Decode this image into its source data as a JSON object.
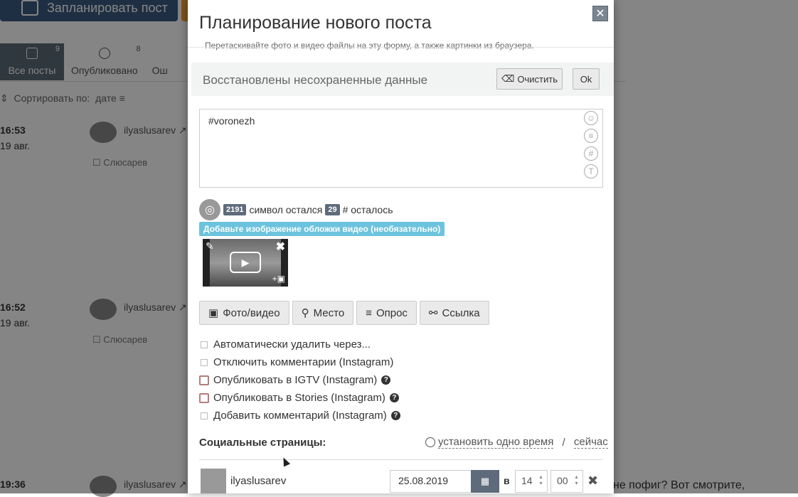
{
  "background": {
    "plan_button": "Запланировать пост",
    "tabs": [
      {
        "label": "Все посты",
        "count": "9"
      },
      {
        "label": "Опубликовано",
        "count": "8"
      },
      {
        "label": "Ош",
        "count": ""
      }
    ],
    "sort_label": "Сортировать по:",
    "sort_value": "дате",
    "posts": [
      {
        "time": "16:53",
        "date": "19 авг.",
        "user": "ilyaslusarev",
        "page": "Слюсарев"
      },
      {
        "time": "16:52",
        "date": "19 авг.",
        "user": "ilyaslusarev",
        "page": "Слюсарев"
      },
      {
        "time": "19:36",
        "date": "",
        "user": "ilyaslusarev",
        "page": ""
      }
    ],
    "right_text": "не пофиг? Вот смотрите,"
  },
  "modal": {
    "title": "Планирование нового поста",
    "subtitle": "Перетаскивайте фото и видео файлы на эту форму, а также картинки из браузера.",
    "restore_text": "Восстановлены несохраненные данные",
    "clear_button": "Очистить",
    "ok_button": "Ok",
    "post_text": "#voronezh",
    "char_count": "2191",
    "char_label": "символ остался",
    "hash_count": "29",
    "hash_label": "# осталось",
    "cover_hint": "Добавьте изображение обложки видео (необязательно)",
    "attach_buttons": {
      "photo": "Фото/видео",
      "place": "Место",
      "poll": "Опрос",
      "link": "Ссылка"
    },
    "options": [
      {
        "label": "Автоматически удалить через...",
        "help": false,
        "highlight": false
      },
      {
        "label": "Отключить комментарии (Instagram)",
        "help": false,
        "highlight": false
      },
      {
        "label": "Опубликовать в IGTV (Instagram)",
        "help": true,
        "highlight": true
      },
      {
        "label": "Опубликовать в Stories (Instagram)",
        "help": true,
        "highlight": true
      },
      {
        "label": "Добавить комментарий (Instagram)",
        "help": true,
        "highlight": false
      }
    ],
    "social_label": "Социальные страницы:",
    "set_one_time": "установить одно время",
    "separator": "/",
    "now": "сейчас",
    "account": {
      "name": "ilyaslusarev",
      "date": "25.08.2019",
      "at": "в",
      "hour": "14",
      "minute": "00"
    }
  }
}
